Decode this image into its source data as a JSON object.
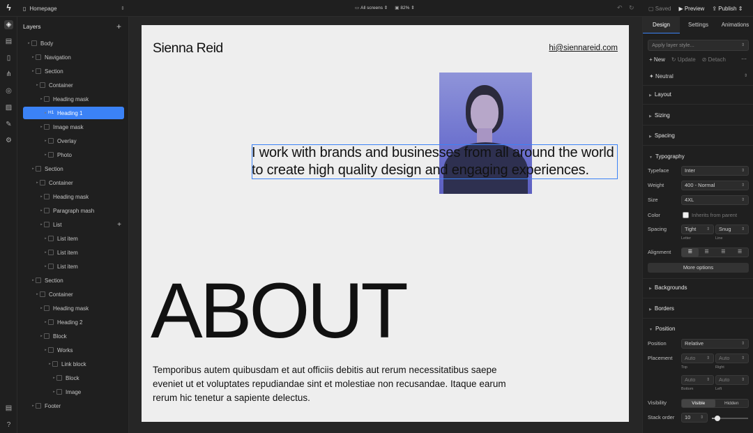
{
  "topbar": {
    "page_name": "Homepage",
    "screens": "All screens",
    "zoom": "82%",
    "saved": "Saved",
    "preview": "Preview",
    "publish": "Publish"
  },
  "layers": {
    "title": "Layers",
    "items": [
      {
        "label": "Body",
        "depth": 0,
        "selected": false
      },
      {
        "label": "Navigation",
        "depth": 1,
        "selected": false
      },
      {
        "label": "Section",
        "depth": 1,
        "selected": false
      },
      {
        "label": "Container",
        "depth": 2,
        "selected": false
      },
      {
        "label": "Heading mask",
        "depth": 3,
        "selected": false
      },
      {
        "label": "Heading 1",
        "depth": 4,
        "selected": true
      },
      {
        "label": "Image mask",
        "depth": 3,
        "selected": false
      },
      {
        "label": "Overlay",
        "depth": 4,
        "selected": false
      },
      {
        "label": "Photo",
        "depth": 4,
        "selected": false
      },
      {
        "label": "Section",
        "depth": 1,
        "selected": false
      },
      {
        "label": "Container",
        "depth": 2,
        "selected": false
      },
      {
        "label": "Heading mask",
        "depth": 3,
        "selected": false
      },
      {
        "label": "Paragraph mash",
        "depth": 3,
        "selected": false
      },
      {
        "label": "List",
        "depth": 3,
        "selected": false
      },
      {
        "label": "List item",
        "depth": 4,
        "selected": false
      },
      {
        "label": "List item",
        "depth": 4,
        "selected": false
      },
      {
        "label": "List item",
        "depth": 4,
        "selected": false
      },
      {
        "label": "Section",
        "depth": 1,
        "selected": false
      },
      {
        "label": "Container",
        "depth": 2,
        "selected": false
      },
      {
        "label": "Heading mask",
        "depth": 3,
        "selected": false
      },
      {
        "label": "Heading 2",
        "depth": 4,
        "selected": false
      },
      {
        "label": "Block",
        "depth": 3,
        "selected": false
      },
      {
        "label": "Works",
        "depth": 4,
        "selected": false
      },
      {
        "label": "Link block",
        "depth": 5,
        "selected": false
      },
      {
        "label": "Block",
        "depth": 6,
        "selected": false
      },
      {
        "label": "Image",
        "depth": 6,
        "selected": false
      },
      {
        "label": "Footer",
        "depth": 1,
        "selected": false
      }
    ]
  },
  "site": {
    "name": "Sienna Reid",
    "email": "hi@siennareid.com",
    "hero": "I work with brands and businesses from all around the world to create high quality design and engaging experiences.",
    "about": "ABOUT",
    "paragraph": "Temporibus autem quibusdam et aut officiis debitis aut rerum necessitatibus saepe eveniet ut et voluptates repudiandae sint et molestiae non recusandae. Itaque earum rerum hic tenetur a sapiente delectus."
  },
  "props": {
    "tabs": [
      "Design",
      "Settings",
      "Animations"
    ],
    "style_placeholder": "Apply layer style...",
    "new": "New",
    "update": "Update",
    "detach": "Detach",
    "neutral": "Neutral",
    "sections": {
      "layout": "Layout",
      "sizing": "Sizing",
      "spacing": "Spacing",
      "typography": "Typography",
      "backgrounds": "Backgrounds",
      "borders": "Borders",
      "position": "Position"
    },
    "typography": {
      "typeface_label": "Typeface",
      "typeface": "Inter",
      "weight_label": "Weight",
      "weight": "400 - Normal",
      "size_label": "Size",
      "size": "4XL",
      "color_label": "Color",
      "color_value": "Inherits from parent",
      "spacing_label": "Spacing",
      "letter": "Tight",
      "line": "Snug",
      "letter_sub": "Letter",
      "line_sub": "Line",
      "alignment_label": "Alignment",
      "more_options": "More options"
    },
    "position": {
      "position_label": "Position",
      "position": "Relative",
      "placement_label": "Placement",
      "top": "Auto",
      "right": "Auto",
      "bottom": "Auto",
      "left": "Auto",
      "top_sub": "Top",
      "right_sub": "Right",
      "bottom_sub": "Bottom",
      "left_sub": "Left",
      "visibility_label": "Visibility",
      "visible": "Visible",
      "hidden": "Hidden",
      "stack_label": "Stack order",
      "stack": "10",
      "stack_slider_fraction": 0.15
    }
  },
  "colors": {
    "accent": "#3b82f6",
    "canvas_bg": "#eeeeee",
    "panel_bg": "#1f1f1f"
  }
}
